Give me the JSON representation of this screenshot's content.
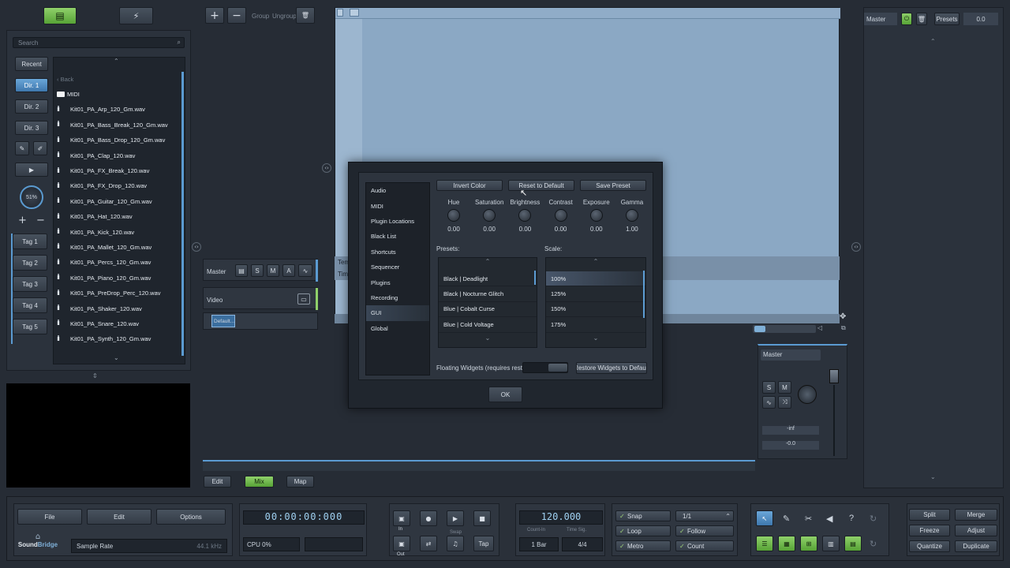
{
  "top_left": {
    "browser_icon": "browser-icon",
    "plugin_icon": "plug-icon"
  },
  "browser": {
    "search_placeholder": "Search",
    "side_buttons": [
      "Recent",
      "Dir. 1",
      "Dir. 2",
      "Dir. 3"
    ],
    "tags": [
      "Tag 1",
      "Tag 2",
      "Tag 3",
      "Tag 4",
      "Tag 5"
    ],
    "volume": "51%",
    "back_label": "‹ Back",
    "files": [
      "MIDI",
      "Kit01_PA_Arp_120_Gm.wav",
      "Kit01_PA_Bass_Break_120_Gm.wav",
      "Kit01_PA_Bass_Drop_120_Gm.wav",
      "Kit01_PA_Clap_120.wav",
      "Kit01_PA_FX_Break_120.wav",
      "Kit01_PA_FX_Drop_120.wav",
      "Kit01_PA_Guitar_120_Gm.wav",
      "Kit01_PA_Hat_120.wav",
      "Kit01_PA_Kick_120.wav",
      "Kit01_PA_Mallet_120_Gm.wav",
      "Kit01_PA_Percs_120_Gm.wav",
      "Kit01_PA_Piano_120_Gm.wav",
      "Kit01_PA_PreDrop_Perc_120.wav",
      "Kit01_PA_Shaker_120.wav",
      "Kit01_PA_Snare_120.wav",
      "Kit01_PA_Synth_120_Gm.wav"
    ]
  },
  "track_toolbar": {
    "group": "Group",
    "ungroup": "Ungroup"
  },
  "tracks": {
    "master": "Master",
    "s": "S",
    "m": "M",
    "a": "A",
    "video": "Video",
    "clip": "Default..."
  },
  "arrange_bits": {
    "tem": "Tem",
    "tim": "Tim"
  },
  "bottom_tabs": [
    "Edit",
    "Mix",
    "Map"
  ],
  "right_panel": {
    "master": "Master",
    "presets": "Presets",
    "value": "0.0"
  },
  "mixer": {
    "master": "Master",
    "inf": "-inf",
    "vol": "-0.0",
    "s": "S",
    "m": "M"
  },
  "dialog": {
    "menu": [
      "Audio",
      "MIDI",
      "Plugin Locations",
      "Black List",
      "Shortcuts",
      "Sequencer",
      "Plugins",
      "Recording",
      "GUI",
      "Global"
    ],
    "selected": "GUI",
    "buttons": {
      "invert": "Invert Color",
      "reset": "Reset to Default",
      "save": "Save Preset"
    },
    "knobs": [
      {
        "label": "Hue",
        "value": "0.00"
      },
      {
        "label": "Saturation",
        "value": "0.00"
      },
      {
        "label": "Brightness",
        "value": "0.00"
      },
      {
        "label": "Contrast",
        "value": "0.00"
      },
      {
        "label": "Exposure",
        "value": "0.00"
      },
      {
        "label": "Gamma",
        "value": "1.00"
      }
    ],
    "presets_label": "Presets:",
    "presets": [
      "Black | Deadlight",
      "Black | Nocturne Glitch",
      "Blue | Cobalt Curse",
      "Blue | Cold Voltage"
    ],
    "scale_label": "Scale:",
    "scales": [
      "100%",
      "125%",
      "150%",
      "175%"
    ],
    "floating": "Floating Widgets (requires restart):",
    "restore": "Restore Widgets to Default",
    "ok": "OK"
  },
  "transport": {
    "file": "File",
    "edit": "Edit",
    "options": "Options",
    "brand_a": "Sound",
    "brand_b": "Bridge",
    "sample_rate": "Sample Rate",
    "sample_rate_val": "44.1 kHz",
    "time": "00:00:00:000",
    "cpu": "CPU 0%",
    "in": "In",
    "out": "Out",
    "swap": "Swap",
    "tap": "Tap",
    "tempo": "120.000",
    "count_in": "Count-In",
    "time_sig": "Time Sig.",
    "bar": "1 Bar",
    "sig": "4/4",
    "snap": "Snap",
    "loop": "Loop",
    "metro": "Metro",
    "quant": "1/1",
    "follow": "Follow",
    "count": "Count",
    "split": "Split",
    "merge": "Merge",
    "freeze": "Freeze",
    "adjust": "Adjust",
    "quantize": "Quantize",
    "duplicate": "Duplicate"
  }
}
